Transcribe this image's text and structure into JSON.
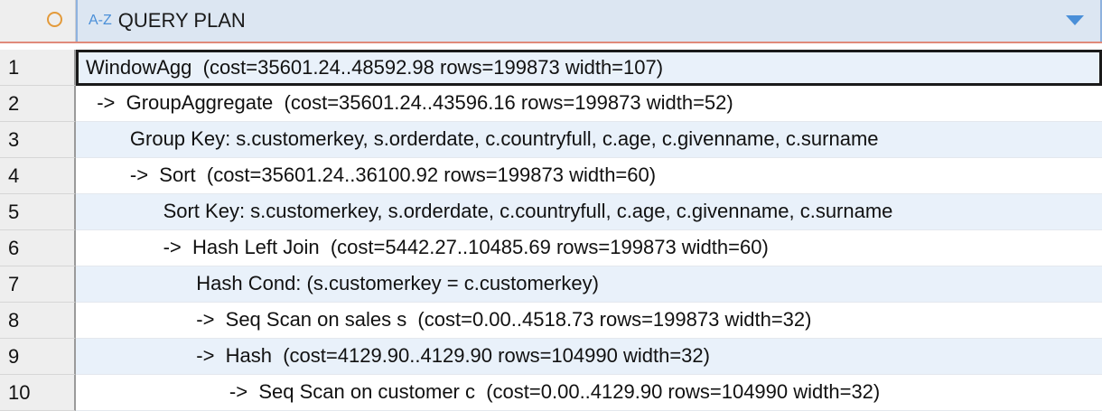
{
  "header": {
    "type_icon": "A-Z",
    "column_title": "QUERY PLAN"
  },
  "rows": [
    {
      "num": "1",
      "text": "WindowAgg  (cost=35601.24..48592.98 rows=199873 width=107)"
    },
    {
      "num": "2",
      "text": "  ->  GroupAggregate  (cost=35601.24..43596.16 rows=199873 width=52)"
    },
    {
      "num": "3",
      "text": "        Group Key: s.customerkey, s.orderdate, c.countryfull, c.age, c.givenname, c.surname"
    },
    {
      "num": "4",
      "text": "        ->  Sort  (cost=35601.24..36100.92 rows=199873 width=60)"
    },
    {
      "num": "5",
      "text": "              Sort Key: s.customerkey, s.orderdate, c.countryfull, c.age, c.givenname, c.surname"
    },
    {
      "num": "6",
      "text": "              ->  Hash Left Join  (cost=5442.27..10485.69 rows=199873 width=60)"
    },
    {
      "num": "7",
      "text": "                    Hash Cond: (s.customerkey = c.customerkey)"
    },
    {
      "num": "8",
      "text": "                    ->  Seq Scan on sales s  (cost=0.00..4518.73 rows=199873 width=32)"
    },
    {
      "num": "9",
      "text": "                    ->  Hash  (cost=4129.90..4129.90 rows=104990 width=32)"
    },
    {
      "num": "10",
      "text": "                          ->  Seq Scan on customer c  (cost=0.00..4129.90 rows=104990 width=32)"
    }
  ]
}
